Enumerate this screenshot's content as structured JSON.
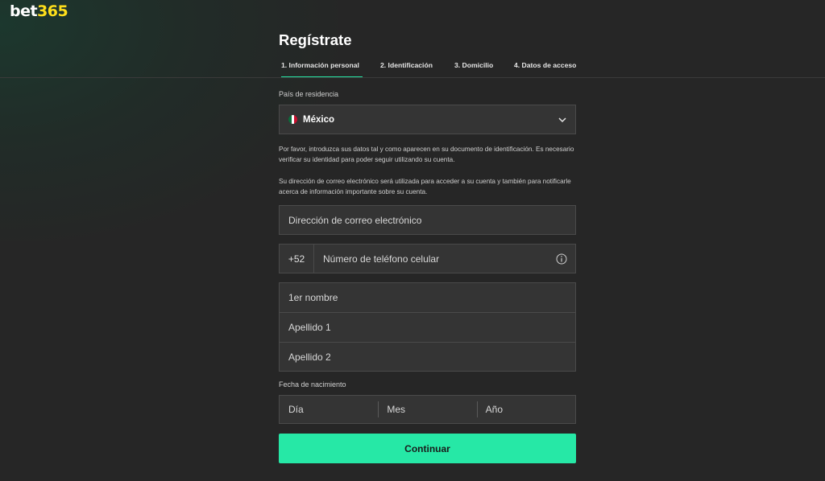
{
  "brand": {
    "part1": "bet",
    "part2": "365"
  },
  "page": {
    "title": "Regístrate"
  },
  "tabs": [
    {
      "label": "1. Información personal",
      "active": true
    },
    {
      "label": "2. Identificación",
      "active": false
    },
    {
      "label": "3. Domicilio",
      "active": false
    },
    {
      "label": "4. Datos de acceso",
      "active": false
    }
  ],
  "country": {
    "label": "País de residencia",
    "value": "México",
    "icon": "mexico-flag-icon"
  },
  "info": {
    "p1": "Por favor, introduzca sus datos tal y como aparecen en su documento de identificación. Es necesario verificar su identidad para poder seguir utilizando su cuenta.",
    "p2": "Su dirección de correo electrónico será utilizada para acceder a su cuenta y también para notificarle acerca de información importante sobre su cuenta."
  },
  "form": {
    "email_placeholder": "Dirección de correo electrónico",
    "phone_prefix": "+52",
    "phone_placeholder": "Número de teléfono celular",
    "first_name_placeholder": "1er nombre",
    "surname1_placeholder": "Apellido 1",
    "surname2_placeholder": "Apellido 2",
    "dob_label": "Fecha de nacimiento",
    "dob_day": "Día",
    "dob_month": "Mes",
    "dob_year": "Año"
  },
  "actions": {
    "continue_label": "Continuar"
  },
  "colors": {
    "accent": "#26e8a6",
    "brand_yellow": "#ffdf1b",
    "background": "#262626",
    "field": "#343434"
  }
}
